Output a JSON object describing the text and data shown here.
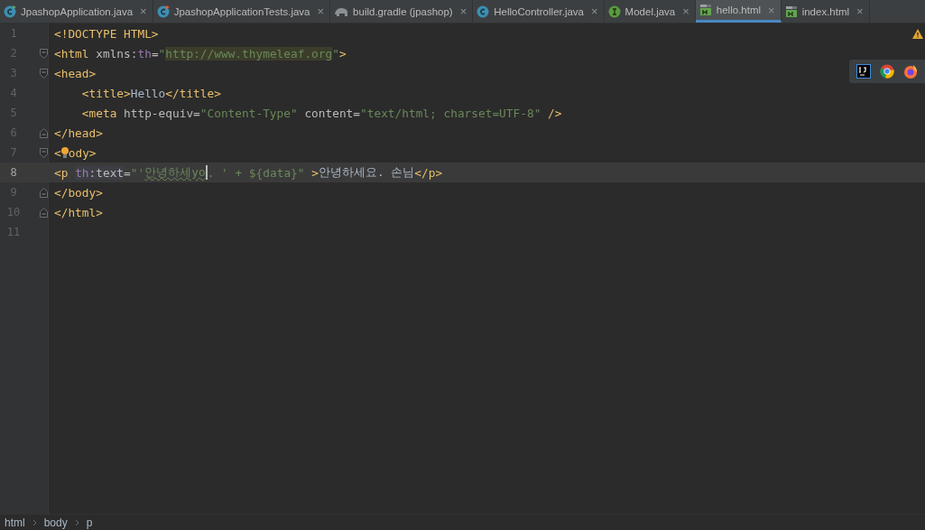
{
  "tabs": [
    {
      "label": "JpashopApplication.java",
      "kind": "class-run",
      "close": "×",
      "selected": false
    },
    {
      "label": "JpashopApplicationTests.java",
      "kind": "class-test",
      "close": "×",
      "selected": false
    },
    {
      "label": "build.gradle (jpashop)",
      "kind": "gradle",
      "close": "×",
      "selected": false
    },
    {
      "label": "HelloController.java",
      "kind": "class",
      "close": "×",
      "selected": false
    },
    {
      "label": "Model.java",
      "kind": "interface",
      "close": "×",
      "selected": false
    },
    {
      "label": "hello.html",
      "kind": "html",
      "close": "×",
      "selected": true
    },
    {
      "label": "index.html",
      "kind": "html",
      "close": "×",
      "selected": false
    }
  ],
  "editor": {
    "lines": [
      {
        "number": "1",
        "kind": "plain",
        "current": false,
        "tokens": [
          {
            "kind": "tag",
            "text": "<!DOCTYPE HTML>"
          }
        ]
      },
      {
        "number": "2",
        "kind": "fold-start",
        "current": false,
        "tokens": [
          {
            "kind": "tag",
            "text": "<html "
          },
          {
            "kind": "attr",
            "text": "xmlns:"
          },
          {
            "kind": "ns",
            "text": "th"
          },
          {
            "kind": "attr",
            "text": "="
          },
          {
            "kind": "str",
            "text": "\""
          },
          {
            "kind": "url",
            "text": "http://www.thymeleaf.org"
          },
          {
            "kind": "str",
            "text": "\""
          },
          {
            "kind": "tag",
            "text": ">"
          }
        ]
      },
      {
        "number": "3",
        "kind": "fold-start",
        "current": false,
        "tokens": [
          {
            "kind": "tag",
            "text": "<head>"
          }
        ]
      },
      {
        "number": "4",
        "kind": "plain",
        "current": false,
        "tokens": [
          {
            "kind": "indent"
          },
          {
            "kind": "tag",
            "text": "<title>"
          },
          {
            "kind": "text",
            "text": "Hello"
          },
          {
            "kind": "tag",
            "text": "</title>"
          }
        ]
      },
      {
        "number": "5",
        "kind": "plain",
        "current": false,
        "tokens": [
          {
            "kind": "indent"
          },
          {
            "kind": "tag",
            "text": "<meta "
          },
          {
            "kind": "attr",
            "text": "http-equiv="
          },
          {
            "kind": "str",
            "text": "\"Content-Type\" "
          },
          {
            "kind": "attr",
            "text": "content="
          },
          {
            "kind": "str",
            "text": "\"text/html; charset=UTF-8\" "
          },
          {
            "kind": "tag",
            "text": "/>"
          }
        ]
      },
      {
        "number": "6",
        "kind": "fold-end",
        "current": false,
        "tokens": [
          {
            "kind": "tag",
            "text": "</head>"
          }
        ]
      },
      {
        "number": "7",
        "kind": "fold-start",
        "current": false,
        "tokens": [
          {
            "kind": "tag",
            "text": "<"
          },
          {
            "kind": "bulb"
          },
          {
            "kind": "tag",
            "text": "ody>"
          }
        ]
      },
      {
        "number": "8",
        "kind": "plain",
        "current": true,
        "tokens": [
          {
            "kind": "tag",
            "text": "<p "
          },
          {
            "kind": "ns-hl",
            "text": "th"
          },
          {
            "kind": "attr-hl",
            "text": ":text"
          },
          {
            "kind": "attr",
            "text": "="
          },
          {
            "kind": "str",
            "text": "\"'"
          },
          {
            "kind": "typo",
            "text": "안녕하세yo"
          },
          {
            "kind": "caret"
          },
          {
            "kind": "str",
            "text": ". ' + ${data}\" "
          },
          {
            "kind": "tag",
            "text": ">"
          },
          {
            "kind": "text",
            "text": "안녕하세요. 손님"
          },
          {
            "kind": "tag",
            "text": "</p>"
          }
        ]
      },
      {
        "number": "9",
        "kind": "fold-end",
        "current": false,
        "tokens": [
          {
            "kind": "tag",
            "text": "</body>"
          }
        ]
      },
      {
        "number": "10",
        "kind": "fold-end",
        "current": false,
        "tokens": [
          {
            "kind": "tag",
            "text": "</html>"
          }
        ]
      },
      {
        "number": "11",
        "kind": "plain",
        "current": false
      }
    ]
  },
  "browser_popup": [
    {
      "kind": "intellij"
    },
    {
      "kind": "chrome"
    },
    {
      "kind": "firefox"
    }
  ],
  "breadcrumbs": [
    "html",
    "body",
    "p"
  ]
}
